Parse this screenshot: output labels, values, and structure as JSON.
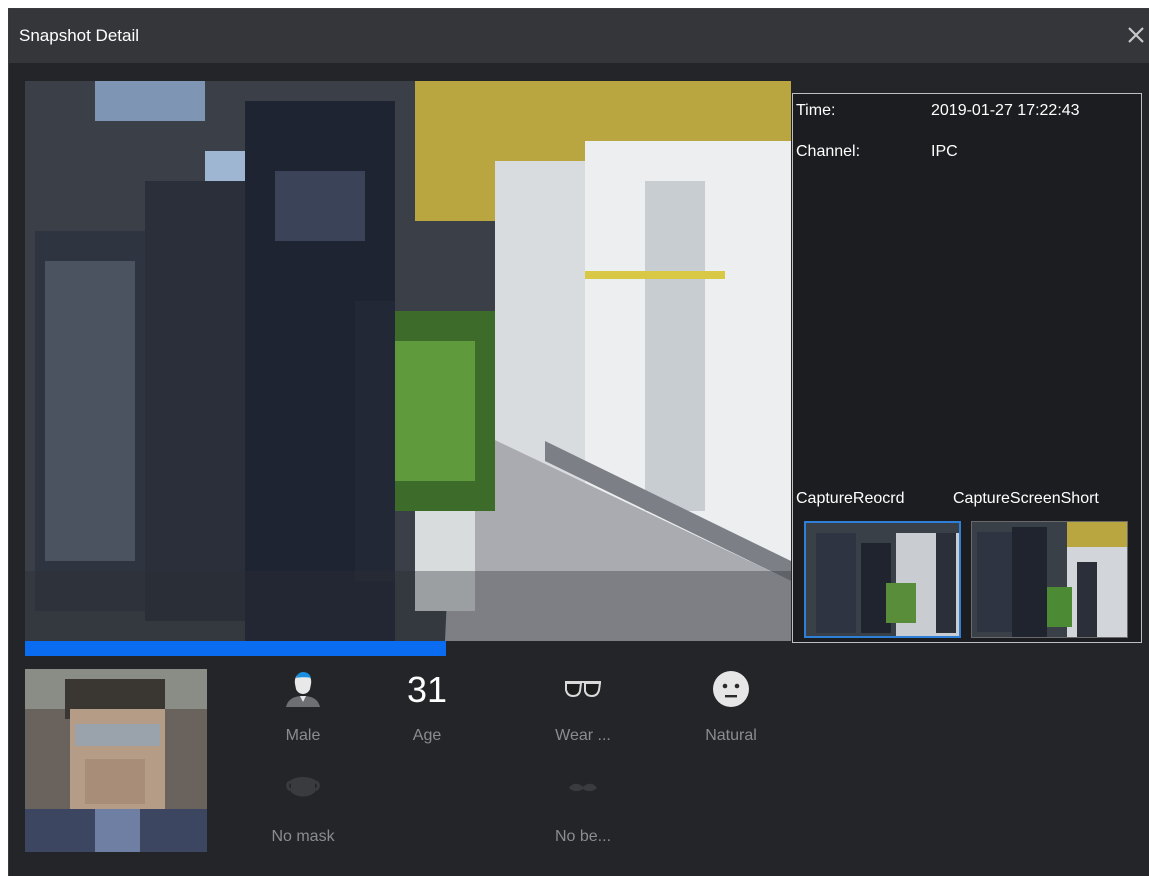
{
  "dialog": {
    "title": "Snapshot Detail",
    "close_icon": "close-icon"
  },
  "playback": {
    "progress_fraction": 0.55
  },
  "info": {
    "time_label": "Time:",
    "time_value": "2019-01-27 17:22:43",
    "channel_label": "Channel:",
    "channel_value": "IPC",
    "capture_record_label": "CaptureReocrd",
    "capture_screenshot_label": "CaptureScreenShort"
  },
  "attributes": {
    "gender": {
      "icon": "male-icon",
      "label": "Male"
    },
    "age": {
      "value": "31",
      "label": "Age"
    },
    "glasses": {
      "icon": "glasses-icon",
      "label": "Wear ..."
    },
    "expression": {
      "icon": "neutral-face-icon",
      "label": "Natural"
    },
    "mask": {
      "icon": "mask-icon",
      "label": "No mask"
    },
    "beard": {
      "icon": "mustache-icon",
      "label": "No be..."
    }
  },
  "colors": {
    "accent": "#0a6cf0",
    "selection": "#2e7fd8",
    "dialog_bg": "#242528",
    "titlebar_bg": "#35363a"
  }
}
